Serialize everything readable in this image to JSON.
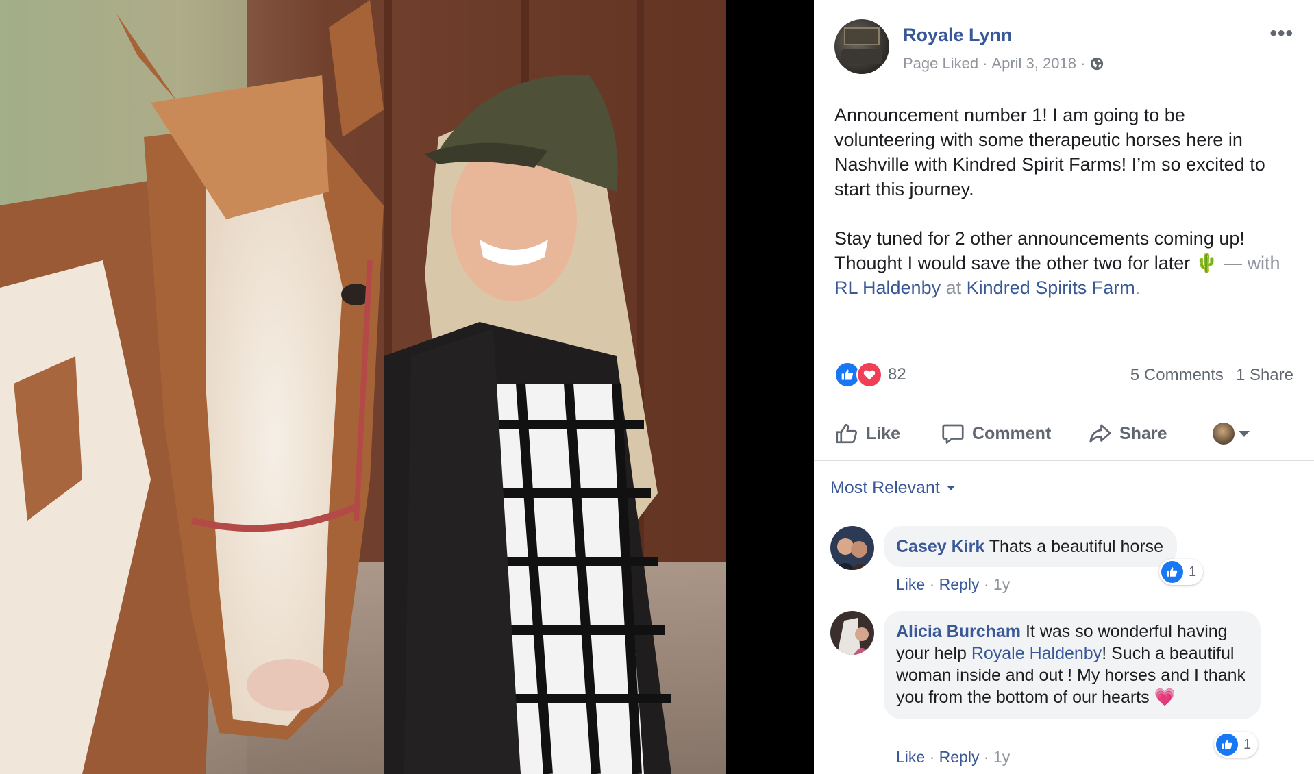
{
  "post": {
    "page_name": "Royale Lynn",
    "status": "Page Liked",
    "date": "April 3, 2018",
    "separator": "·",
    "more_label": "•••",
    "text_p1": "Announcement number 1! I am going to be volunteering with some therapeutic horses here in Nashville with Kindred Spirit Farms! I’m so excited to start this journey.",
    "text_p2": "Stay tuned for 2 other announcements coming up! Thought I would save the other two for later",
    "emoji": "🌵",
    "dash": " — ",
    "with_word": "with",
    "tagged_person": "RL Haldenby",
    "at_word": "at",
    "location": "Kindred Spirits Farm",
    "period": "."
  },
  "stats": {
    "reaction_count": "82",
    "comments": "5 Comments",
    "shares": "1 Share"
  },
  "actions": {
    "like": "Like",
    "comment": "Comment",
    "share": "Share"
  },
  "sort": {
    "label": "Most Relevant"
  },
  "comments": [
    {
      "author": "Casey Kirk",
      "text": "Thats a beautiful horse",
      "like": "Like",
      "reply": "Reply",
      "time": "1y",
      "reaction_count": "1"
    },
    {
      "author": "Alicia Burcham",
      "text_before": "It was so wonderful having your help",
      "mention": "Royale Haldenby",
      "text_after": "! Such a beautiful woman inside and out ! My horses and I thank you from the bottom of our hearts",
      "emoji": "💗",
      "like": "Like",
      "reply": "Reply",
      "time": "1y",
      "reaction_count": "1"
    }
  ],
  "colors": {
    "link_blue": "#385898",
    "like_blue": "#1877f2",
    "love_red": "#f33e58",
    "muted_gray": "#90949c"
  },
  "icons": [
    "globe-icon",
    "like-reaction-icon",
    "love-reaction-icon",
    "thumbs-up-icon",
    "comment-icon",
    "share-icon",
    "chevron-down-icon"
  ]
}
